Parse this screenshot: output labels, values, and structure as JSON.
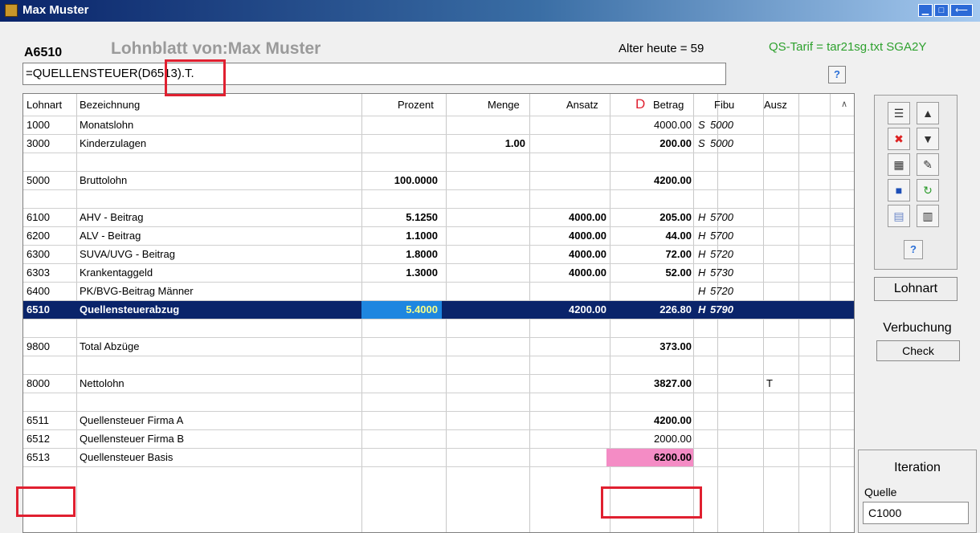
{
  "window": {
    "title": "Max Muster"
  },
  "header": {
    "id": "A6510",
    "title": "Lohnblatt von:Max Muster",
    "age": "Alter heute = 59",
    "tarif": "QS-Tarif = tar21sg.txt SGA2Y"
  },
  "formula": {
    "value": "=QUELLENSTEUER(D6513).T."
  },
  "columns": {
    "lohnart": "Lohnart",
    "bezeichnung": "Bezeichnung",
    "prozent": "Prozent",
    "menge": "Menge",
    "ansatz": "Ansatz",
    "d": "D",
    "betrag": "Betrag",
    "fibu": "Fibu",
    "ausz": "Ausz"
  },
  "rows": [
    {
      "lohnart": "1000",
      "bez": "Monatslohn",
      "prozent": "",
      "menge": "",
      "ansatz": "",
      "betrag": "4000.00",
      "sh": "S",
      "fibu": "5000",
      "ausz": ""
    },
    {
      "lohnart": "3000",
      "bez": "Kinderzulagen",
      "prozent": "",
      "menge": "1.00",
      "ansatz": "",
      "betrag": "200.00",
      "sh": "S",
      "fibu": "5000",
      "ausz": ""
    },
    {
      "lohnart": "",
      "bez": "",
      "prozent": "",
      "menge": "",
      "ansatz": "",
      "betrag": "",
      "sh": "",
      "fibu": "",
      "ausz": ""
    },
    {
      "lohnart": "5000",
      "bez": "Bruttolohn",
      "prozent": "100.0000",
      "menge": "",
      "ansatz": "",
      "betrag": "4200.00",
      "sh": "",
      "fibu": "",
      "ausz": ""
    },
    {
      "lohnart": "",
      "bez": "",
      "prozent": "",
      "menge": "",
      "ansatz": "",
      "betrag": "",
      "sh": "",
      "fibu": "",
      "ausz": ""
    },
    {
      "lohnart": "6100",
      "bez": "AHV - Beitrag",
      "prozent": "5.1250",
      "menge": "",
      "ansatz": "4000.00",
      "betrag": "205.00",
      "sh": "H",
      "fibu": "5700",
      "ausz": ""
    },
    {
      "lohnart": "6200",
      "bez": "ALV - Beitrag",
      "prozent": "1.1000",
      "menge": "",
      "ansatz": "4000.00",
      "betrag": "44.00",
      "sh": "H",
      "fibu": "5700",
      "ausz": ""
    },
    {
      "lohnart": "6300",
      "bez": "SUVA/UVG - Beitrag",
      "prozent": "1.8000",
      "menge": "",
      "ansatz": "4000.00",
      "betrag": "72.00",
      "sh": "H",
      "fibu": "5720",
      "ausz": ""
    },
    {
      "lohnart": "6303",
      "bez": "Krankentaggeld",
      "prozent": "1.3000",
      "menge": "",
      "ansatz": "4000.00",
      "betrag": "52.00",
      "sh": "H",
      "fibu": "5730",
      "ausz": ""
    },
    {
      "lohnart": "6400",
      "bez": "PK/BVG-Beitrag Männer",
      "prozent": "",
      "menge": "",
      "ansatz": "",
      "betrag": "",
      "sh": "H",
      "fibu": "5720",
      "ausz": ""
    },
    {
      "lohnart": "6510",
      "bez": "Quellensteuerabzug",
      "prozent": "5.4000",
      "menge": "",
      "ansatz": "4200.00",
      "betrag": "226.80",
      "sh": "H",
      "fibu": "5790",
      "ausz": ""
    },
    {
      "lohnart": "",
      "bez": "",
      "prozent": "",
      "menge": "",
      "ansatz": "",
      "betrag": "",
      "sh": "",
      "fibu": "",
      "ausz": ""
    },
    {
      "lohnart": "9800",
      "bez": "Total Abzüge",
      "prozent": "",
      "menge": "",
      "ansatz": "",
      "betrag": "373.00",
      "sh": "",
      "fibu": "",
      "ausz": ""
    },
    {
      "lohnart": "",
      "bez": "",
      "prozent": "",
      "menge": "",
      "ansatz": "",
      "betrag": "",
      "sh": "",
      "fibu": "",
      "ausz": ""
    },
    {
      "lohnart": "8000",
      "bez": "Nettolohn",
      "prozent": "",
      "menge": "",
      "ansatz": "",
      "betrag": "3827.00",
      "sh": "",
      "fibu": "",
      "ausz": "T"
    },
    {
      "lohnart": "",
      "bez": "",
      "prozent": "",
      "menge": "",
      "ansatz": "",
      "betrag": "",
      "sh": "",
      "fibu": "",
      "ausz": ""
    },
    {
      "lohnart": "6511",
      "bez": "Quellensteuer Firma A",
      "prozent": "",
      "menge": "",
      "ansatz": "",
      "betrag": "4200.00",
      "sh": "",
      "fibu": "",
      "ausz": ""
    },
    {
      "lohnart": "6512",
      "bez": "Quellensteuer Firma B",
      "prozent": "",
      "menge": "",
      "ansatz": "",
      "betrag": "2000.00",
      "sh": "",
      "fibu": "",
      "ausz": ""
    },
    {
      "lohnart": "6513",
      "bez": "Quellensteuer Basis",
      "prozent": "",
      "menge": "",
      "ansatz": "",
      "betrag": "6200.00",
      "sh": "",
      "fibu": "",
      "ausz": ""
    },
    {
      "lohnart": "",
      "bez": "",
      "prozent": "",
      "menge": "",
      "ansatz": "",
      "betrag": "",
      "sh": "",
      "fibu": "",
      "ausz": ""
    }
  ],
  "selected_row": "6510",
  "highlight_row": "6513",
  "sidebar": {
    "lohnart_button": "Lohnart",
    "verbuchung_label": "Verbuchung",
    "check_button": "Check",
    "iteration_title": "Iteration",
    "quelle_label": "Quelle",
    "quelle_value": "C1000",
    "help": "?"
  },
  "colors": {
    "selected_bg": "#0a246a",
    "pink": "#f48cc5",
    "redbox": "#e02030",
    "tarif": "#2ea12e"
  }
}
